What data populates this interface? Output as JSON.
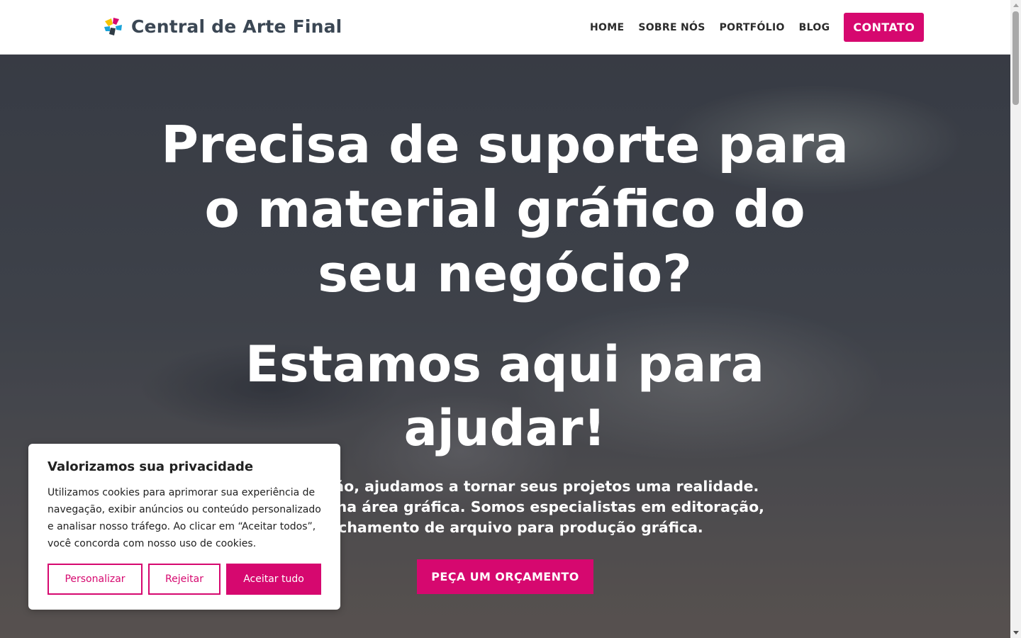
{
  "header": {
    "brand_name": "Central de Arte Final",
    "nav": [
      {
        "label": "HOME"
      },
      {
        "label": "SOBRE NÓS"
      },
      {
        "label": "PORTFÓLIO"
      },
      {
        "label": "BLOG"
      }
    ],
    "cta_label": "CONTATO"
  },
  "hero": {
    "title": "Precisa de suporte para o material gráfico do seu negócio?",
    "subtitle": "Estamos aqui para ajudar!",
    "description_lines": [
      "a finalização, ajudamos a tornar seus projetos uma realidade.",
      "xperiência na área gráfica. Somos especialistas em editoração,",
      "e fechamento de arquivo para produção gráfica."
    ],
    "button_label": "PEÇA UM ORÇAMENTO"
  },
  "cookie_banner": {
    "title": "Valorizamos sua privacidade",
    "text": "Utilizamos cookies para aprimorar sua experiência de navegação, exibir anúncios ou conteúdo personalizado e analisar nosso tráfego. Ao clicar em “Aceitar todos”, você concorda com nosso uso de cookies.",
    "customize_label": "Personalizar",
    "reject_label": "Rejeitar",
    "accept_label": "Aceitar tudo"
  },
  "colors": {
    "accent": "#d6086f",
    "brand_text": "#3b4754"
  }
}
